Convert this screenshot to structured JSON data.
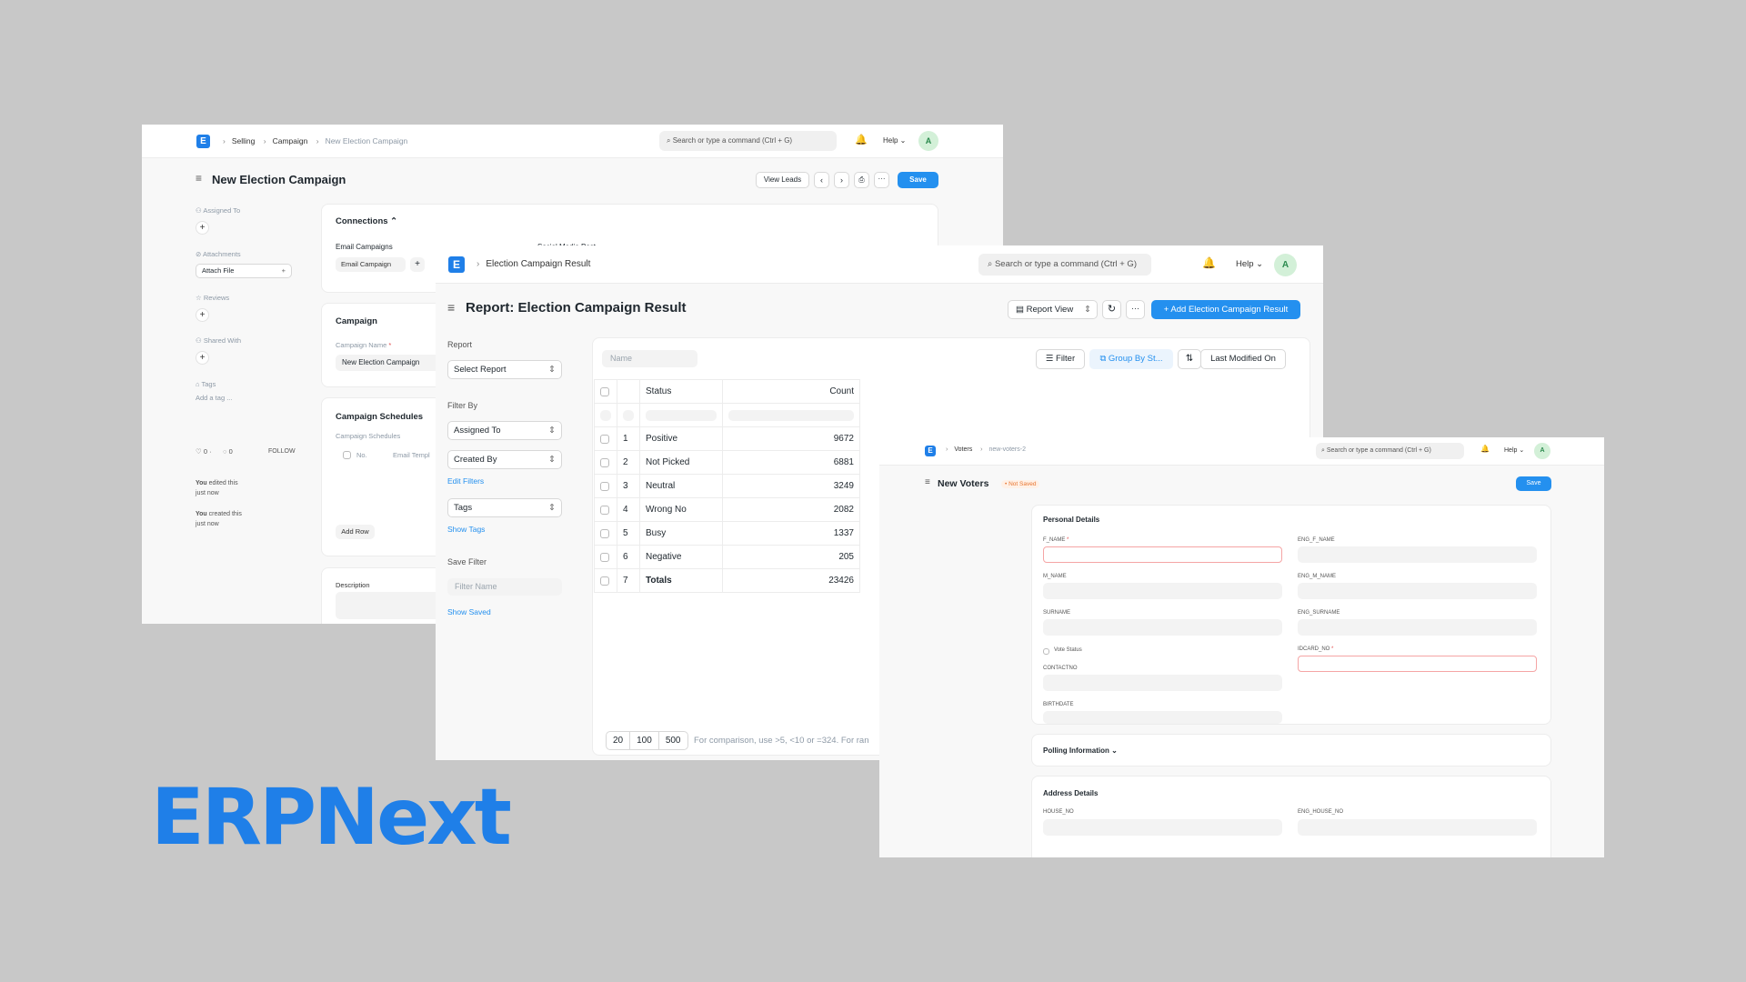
{
  "brand": {
    "logo_text": "ERPNext",
    "color": "#1f7fe8"
  },
  "campaign_window": {
    "logo_letter": "E",
    "breadcrumbs": [
      "Selling",
      "Campaign",
      "New Election Campaign"
    ],
    "search_placeholder": "Search or type a command (Ctrl + G)",
    "help_label": "Help",
    "avatar_letter": "A",
    "page_title": "New Election Campaign",
    "view_leads_label": "View Leads",
    "more_label": "···",
    "save_label": "Save",
    "sidebar": {
      "assigned_to": "Assigned To",
      "attachments": "Attachments",
      "attach_file": "Attach File",
      "reviews": "Reviews",
      "shared_with": "Shared With",
      "tags": "Tags",
      "add_tag": "Add a tag ...",
      "likes": "0",
      "comments": "0",
      "follow": "FOLLOW",
      "activity": [
        {
          "who": "You",
          "what": "edited this",
          "when": "just now"
        },
        {
          "who": "You",
          "what": "created this",
          "when": "just now"
        }
      ]
    },
    "connections": {
      "title": "Connections",
      "email_campaigns_label": "Email Campaigns",
      "email_campaign_chip": "Email Campaign",
      "social_media_label": "Social Media Post"
    },
    "campaign_section": {
      "title": "Campaign",
      "name_label": "Campaign Name",
      "name_value": "New Election Campaign"
    },
    "schedules_section": {
      "title": "Campaign Schedules",
      "table_label": "Campaign Schedules",
      "col_no": "No.",
      "col_email": "Email Templ",
      "add_row": "Add Row"
    },
    "description_label": "Description"
  },
  "report_window": {
    "logo_letter": "E",
    "breadcrumb": "Election Campaign Result",
    "search_placeholder": "Search or type a command (Ctrl + G)",
    "help_label": "Help",
    "avatar_letter": "A",
    "page_title": "Report: Election Campaign Result",
    "report_view_label": "Report View",
    "more_label": "···",
    "add_button": "+ Add Election Campaign Result",
    "sidebar": {
      "report_label": "Report",
      "select_report": "Select Report",
      "filter_by": "Filter By",
      "assigned_to": "Assigned To",
      "created_by": "Created By",
      "edit_filters": "Edit Filters",
      "tags": "Tags",
      "show_tags": "Show Tags",
      "save_filter": "Save Filter",
      "filter_name_placeholder": "Filter Name",
      "show_saved": "Show Saved"
    },
    "toolbar": {
      "name_placeholder": "Name",
      "filter": "Filter",
      "group_by": "Group By St...",
      "sort": "Last Modified On"
    },
    "table": {
      "headers": [
        "Status",
        "Count"
      ],
      "rows": [
        {
          "n": "1",
          "status": "Positive",
          "count": "9672"
        },
        {
          "n": "2",
          "status": "Not Picked",
          "count": "6881"
        },
        {
          "n": "3",
          "status": "Neutral",
          "count": "3249"
        },
        {
          "n": "4",
          "status": "Wrong No",
          "count": "2082"
        },
        {
          "n": "5",
          "status": "Busy",
          "count": "1337"
        },
        {
          "n": "6",
          "status": "Negative",
          "count": "205"
        },
        {
          "n": "7",
          "status": "Totals",
          "count": "23426"
        }
      ]
    },
    "pager": [
      "20",
      "100",
      "500"
    ],
    "pager_hint": "For comparison, use >5, <10 or =324. For ran"
  },
  "voters_window": {
    "logo_letter": "E",
    "breadcrumbs": [
      "Voters",
      "new-voters-2"
    ],
    "search_placeholder": "Search or type a command (Ctrl + G)",
    "help_label": "Help",
    "avatar_letter": "A",
    "page_title": "New Voters",
    "status_badge": "• Not Saved",
    "save_label": "Save",
    "personal_details": {
      "title": "Personal Details",
      "f_name": "F_NAME",
      "eng_f_name": "ENG_F_NAME",
      "m_name": "M_NAME",
      "eng_m_name": "ENG_M_NAME",
      "surname": "SURNAME",
      "eng_surname": "ENG_SURNAME",
      "vote_status": "Vote Status",
      "idcard_no": "IDCARD_NO",
      "contact_no": "CONTACTNO",
      "birthdate": "BIRTHDATE"
    },
    "polling_title": "Polling Information",
    "address_details": {
      "title": "Address Details",
      "house_no": "HOUSE_NO",
      "eng_house_no": "ENG_HOUSE_NO"
    }
  }
}
